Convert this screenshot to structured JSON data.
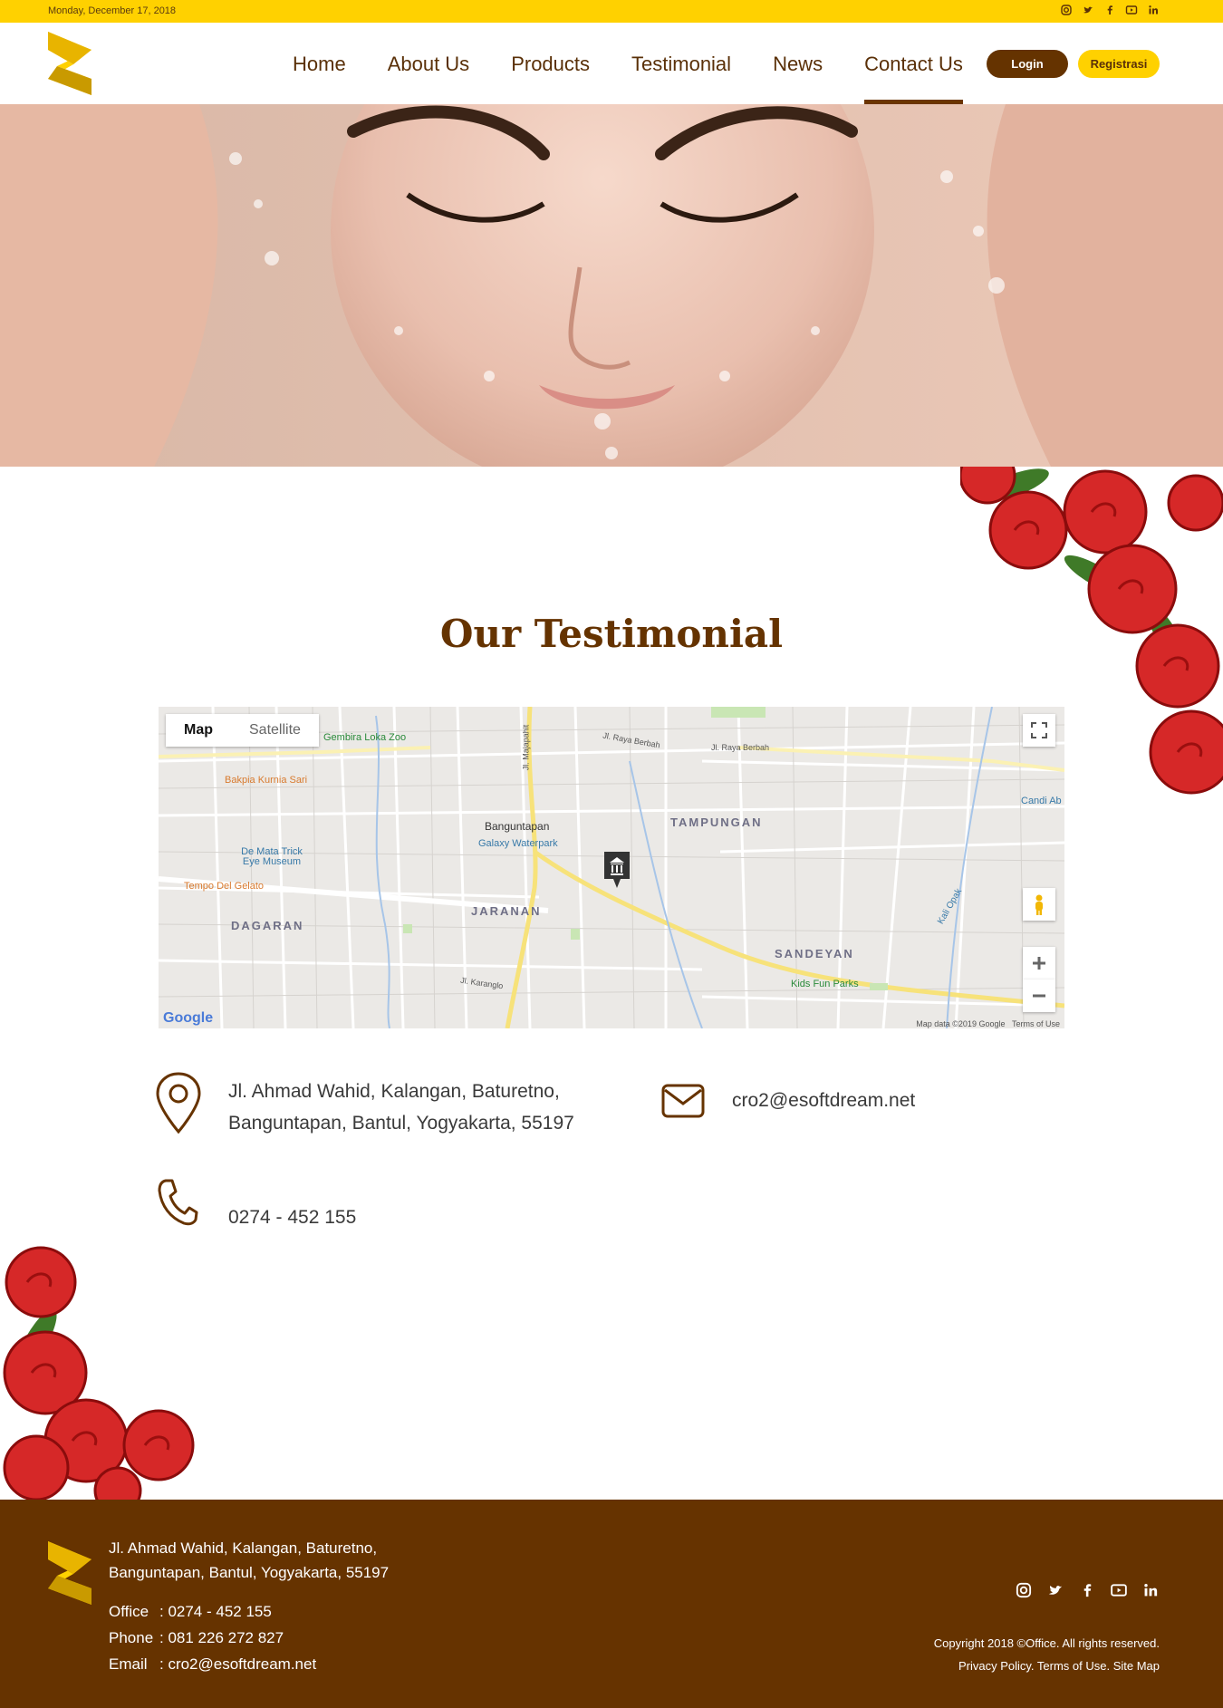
{
  "topbar": {
    "date": "Monday, December 17, 2018",
    "social_icons": [
      "instagram-icon",
      "twitter-icon",
      "facebook-icon",
      "youtube-icon",
      "linkedin-icon"
    ]
  },
  "nav": {
    "items": [
      {
        "label": "Home",
        "active": false
      },
      {
        "label": "About Us",
        "active": false
      },
      {
        "label": "Products",
        "active": false
      },
      {
        "label": "Testimonial",
        "active": false
      },
      {
        "label": "News",
        "active": false
      },
      {
        "label": "Contact Us",
        "active": true
      }
    ],
    "login_label": "Login",
    "register_label": "Registrasi"
  },
  "section": {
    "title": "Our Testimonial"
  },
  "map": {
    "tabs": [
      "Map",
      "Satellite"
    ],
    "areas": [
      "TAMPUNGAN",
      "JARANAN",
      "DAGARAN",
      "SANDEYAN"
    ],
    "places": {
      "zoo": "Gembira Loka Zoo",
      "bakpia": "Bakpia Kurnia Sari",
      "museum": "De Mata Trick Eye Museum",
      "gelato": "Tempo Del Gelato",
      "banguntapan": "Banguntapan",
      "waterpark": "Galaxy Waterpark",
      "kidsfun": "Kids Fun Parks",
      "candi": "Candi Ab"
    },
    "roads": {
      "raya_berbah1": "Jl. Raya Berbah",
      "raya_berbah2": "Jl. Raya Berbah",
      "karanglo": "Jl. Karanglo",
      "majapahit": "Jl. Majapahit",
      "kali_opak": "Kali Opak"
    },
    "attribution": "Map data ©2019 Google",
    "terms": "Terms of Use",
    "google": "Google"
  },
  "contact": {
    "address_line1": "Jl. Ahmad Wahid, Kalangan, Baturetno,",
    "address_line2": "Banguntapan, Bantul, Yogyakarta, 55197",
    "email": "cro2@esoftdream.net",
    "phone": "0274 - 452 155"
  },
  "footer": {
    "address_line1": "Jl. Ahmad Wahid, Kalangan, Baturetno,",
    "address_line2": "Banguntapan, Bantul, Yogyakarta, 55197",
    "office_key": "Office",
    "office_val": ": 0274 - 452 155",
    "phone_key": "Phone",
    "phone_val": ": 081 226 272 827",
    "email_key": "Email",
    "email_val": ": cro2@esoftdream.net",
    "copyright": "Copyright 2018 ©Office. All rights reserved.",
    "links": "Privacy Policy. Terms of Use. Site Map"
  },
  "colors": {
    "brand_yellow": "#ffd100",
    "brand_brown": "#663300"
  }
}
